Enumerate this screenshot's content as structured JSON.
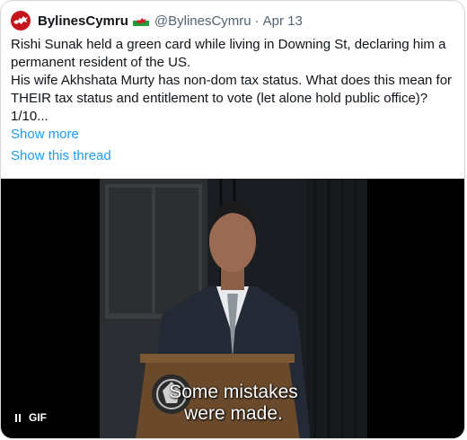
{
  "author": {
    "display_name": "BylinesCymru",
    "handle": "@BylinesCymru",
    "separator": "·",
    "date": "Apr 13",
    "flag_icon": "wales-flag-icon",
    "avatar_icon": "dragon-logo-icon"
  },
  "tweet": {
    "lines": [
      "Rishi Sunak held a green card while living in Downing St, declaring him a permanent resident of the US.",
      "His wife Akhshata Murty has non-dom tax status. What does this mean for THEIR tax status and entitlement to vote (let alone hold public office)? 1/10..."
    ]
  },
  "actions": {
    "show_more": "Show more",
    "show_thread": "Show this thread"
  },
  "media": {
    "subtitle_line1": "Some mistakes",
    "subtitle_line2": "were made.",
    "gif_label": "GIF",
    "pause_icon": "pause-icon"
  },
  "colors": {
    "link": "#1d9bf0",
    "text": "#0f1419",
    "muted": "#536471",
    "avatar": "#c4161c"
  }
}
